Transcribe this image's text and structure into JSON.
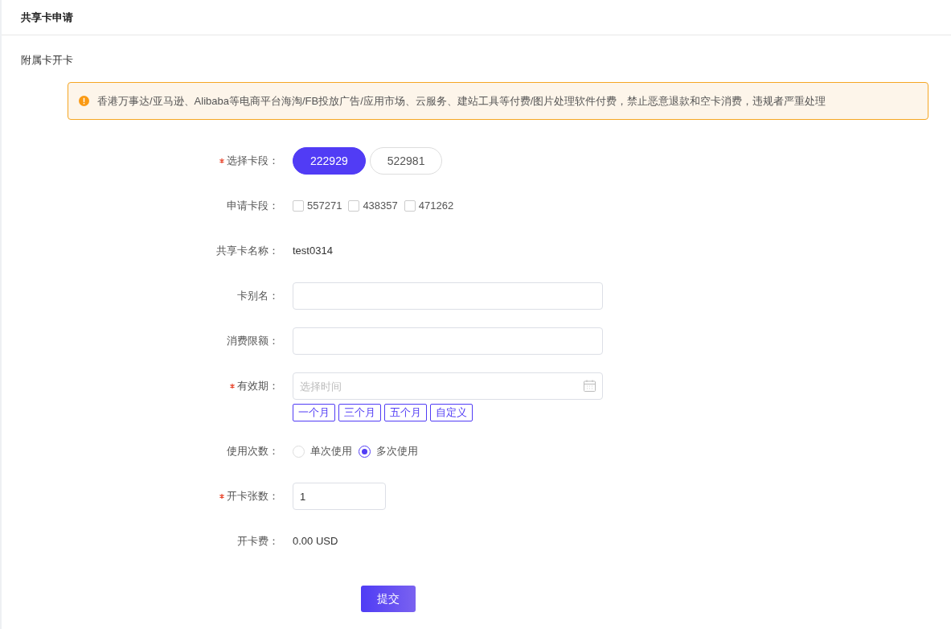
{
  "header": {
    "title": "共享卡申请"
  },
  "section": {
    "title": "附属卡开卡"
  },
  "alert": {
    "text": "香港万事达/亚马逊、Alibaba等电商平台海淘/FB投放广告/应用市场、云服务、建站工具等付费/图片处理软件付费，禁止恶意退款和空卡消费，违规者严重处理"
  },
  "form": {
    "fields": [
      {
        "kind": "segments",
        "label": "选择卡段：",
        "required": true,
        "options": [
          {
            "label": "222929",
            "selected": true
          },
          {
            "label": "522981",
            "selected": false
          }
        ]
      },
      {
        "kind": "checkboxes",
        "label": "申请卡段：",
        "required": false,
        "options": [
          {
            "label": "557271",
            "checked": false
          },
          {
            "label": "438357",
            "checked": false
          },
          {
            "label": "471262",
            "checked": false
          }
        ]
      },
      {
        "kind": "text",
        "label": "共享卡名称：",
        "required": false,
        "value": "test0314"
      },
      {
        "kind": "input",
        "label": "卡别名：",
        "required": false
      },
      {
        "kind": "input",
        "label": "消费限额：",
        "required": false
      },
      {
        "kind": "date",
        "label": "有效期：",
        "required": true,
        "placeholder": "选择时间",
        "presets": [
          "一个月",
          "三个月",
          "五个月",
          "自定义"
        ]
      },
      {
        "kind": "radios",
        "label": "使用次数：",
        "required": false,
        "options": [
          {
            "label": "单次使用",
            "selected": false
          },
          {
            "label": "多次使用",
            "selected": true
          }
        ]
      },
      {
        "kind": "number",
        "label": "开卡张数：",
        "required": true,
        "value": "1"
      },
      {
        "kind": "text",
        "label": "开卡费：",
        "required": false,
        "value": "0.00 USD"
      }
    ],
    "submit": "提交"
  }
}
